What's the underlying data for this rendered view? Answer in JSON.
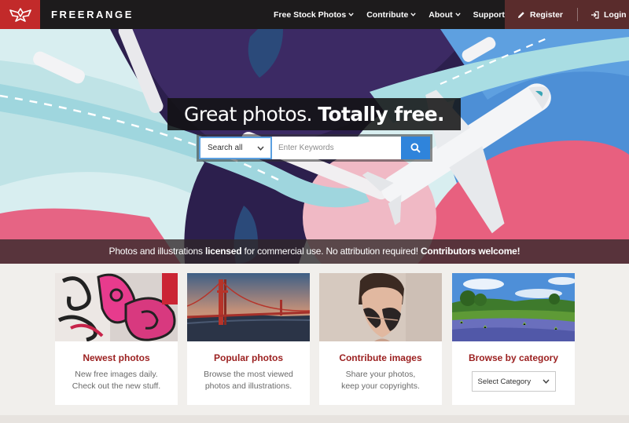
{
  "header": {
    "brand": "FREERANGE",
    "nav": [
      {
        "label": "Free Stock Photos"
      },
      {
        "label": "Contribute"
      },
      {
        "label": "About"
      },
      {
        "label": "Support"
      }
    ],
    "register_label": "Register",
    "login_label": "Login"
  },
  "hero": {
    "headline_regular": "Great photos.",
    "headline_bold": "Totally free.",
    "search": {
      "scope_value": "Search all",
      "placeholder": "Enter Keywords"
    },
    "ribbon": {
      "part1": "Photos and illustrations ",
      "part2_bold": "licensed",
      "part3": " for commercial use. No attribution required! ",
      "part4_bold": "Contributors welcome!"
    }
  },
  "cards": [
    {
      "title": "Newest photos",
      "line1": "New free images daily.",
      "line2": "Check out the new stuff."
    },
    {
      "title": "Popular photos",
      "line1": "Browse the most viewed",
      "line2": "photos and illustrations."
    },
    {
      "title": "Contribute images",
      "line1": "Share your photos,",
      "line2": "keep your copyrights."
    },
    {
      "title": "Browse by category",
      "select_value": "Select Category"
    }
  ],
  "colors": {
    "brand_red": "#c22a2a",
    "topbar": "#1d1b1c",
    "auth_bg": "#5a2c2c",
    "search_blue": "#2f84db",
    "card_title": "#9b1f1f"
  },
  "icons": {
    "logo": "freerange-bird-logo-icon",
    "register": "pencil-icon",
    "login": "sign-in-icon",
    "search": "magnifier-icon",
    "dropdown": "chevron-down-icon"
  }
}
